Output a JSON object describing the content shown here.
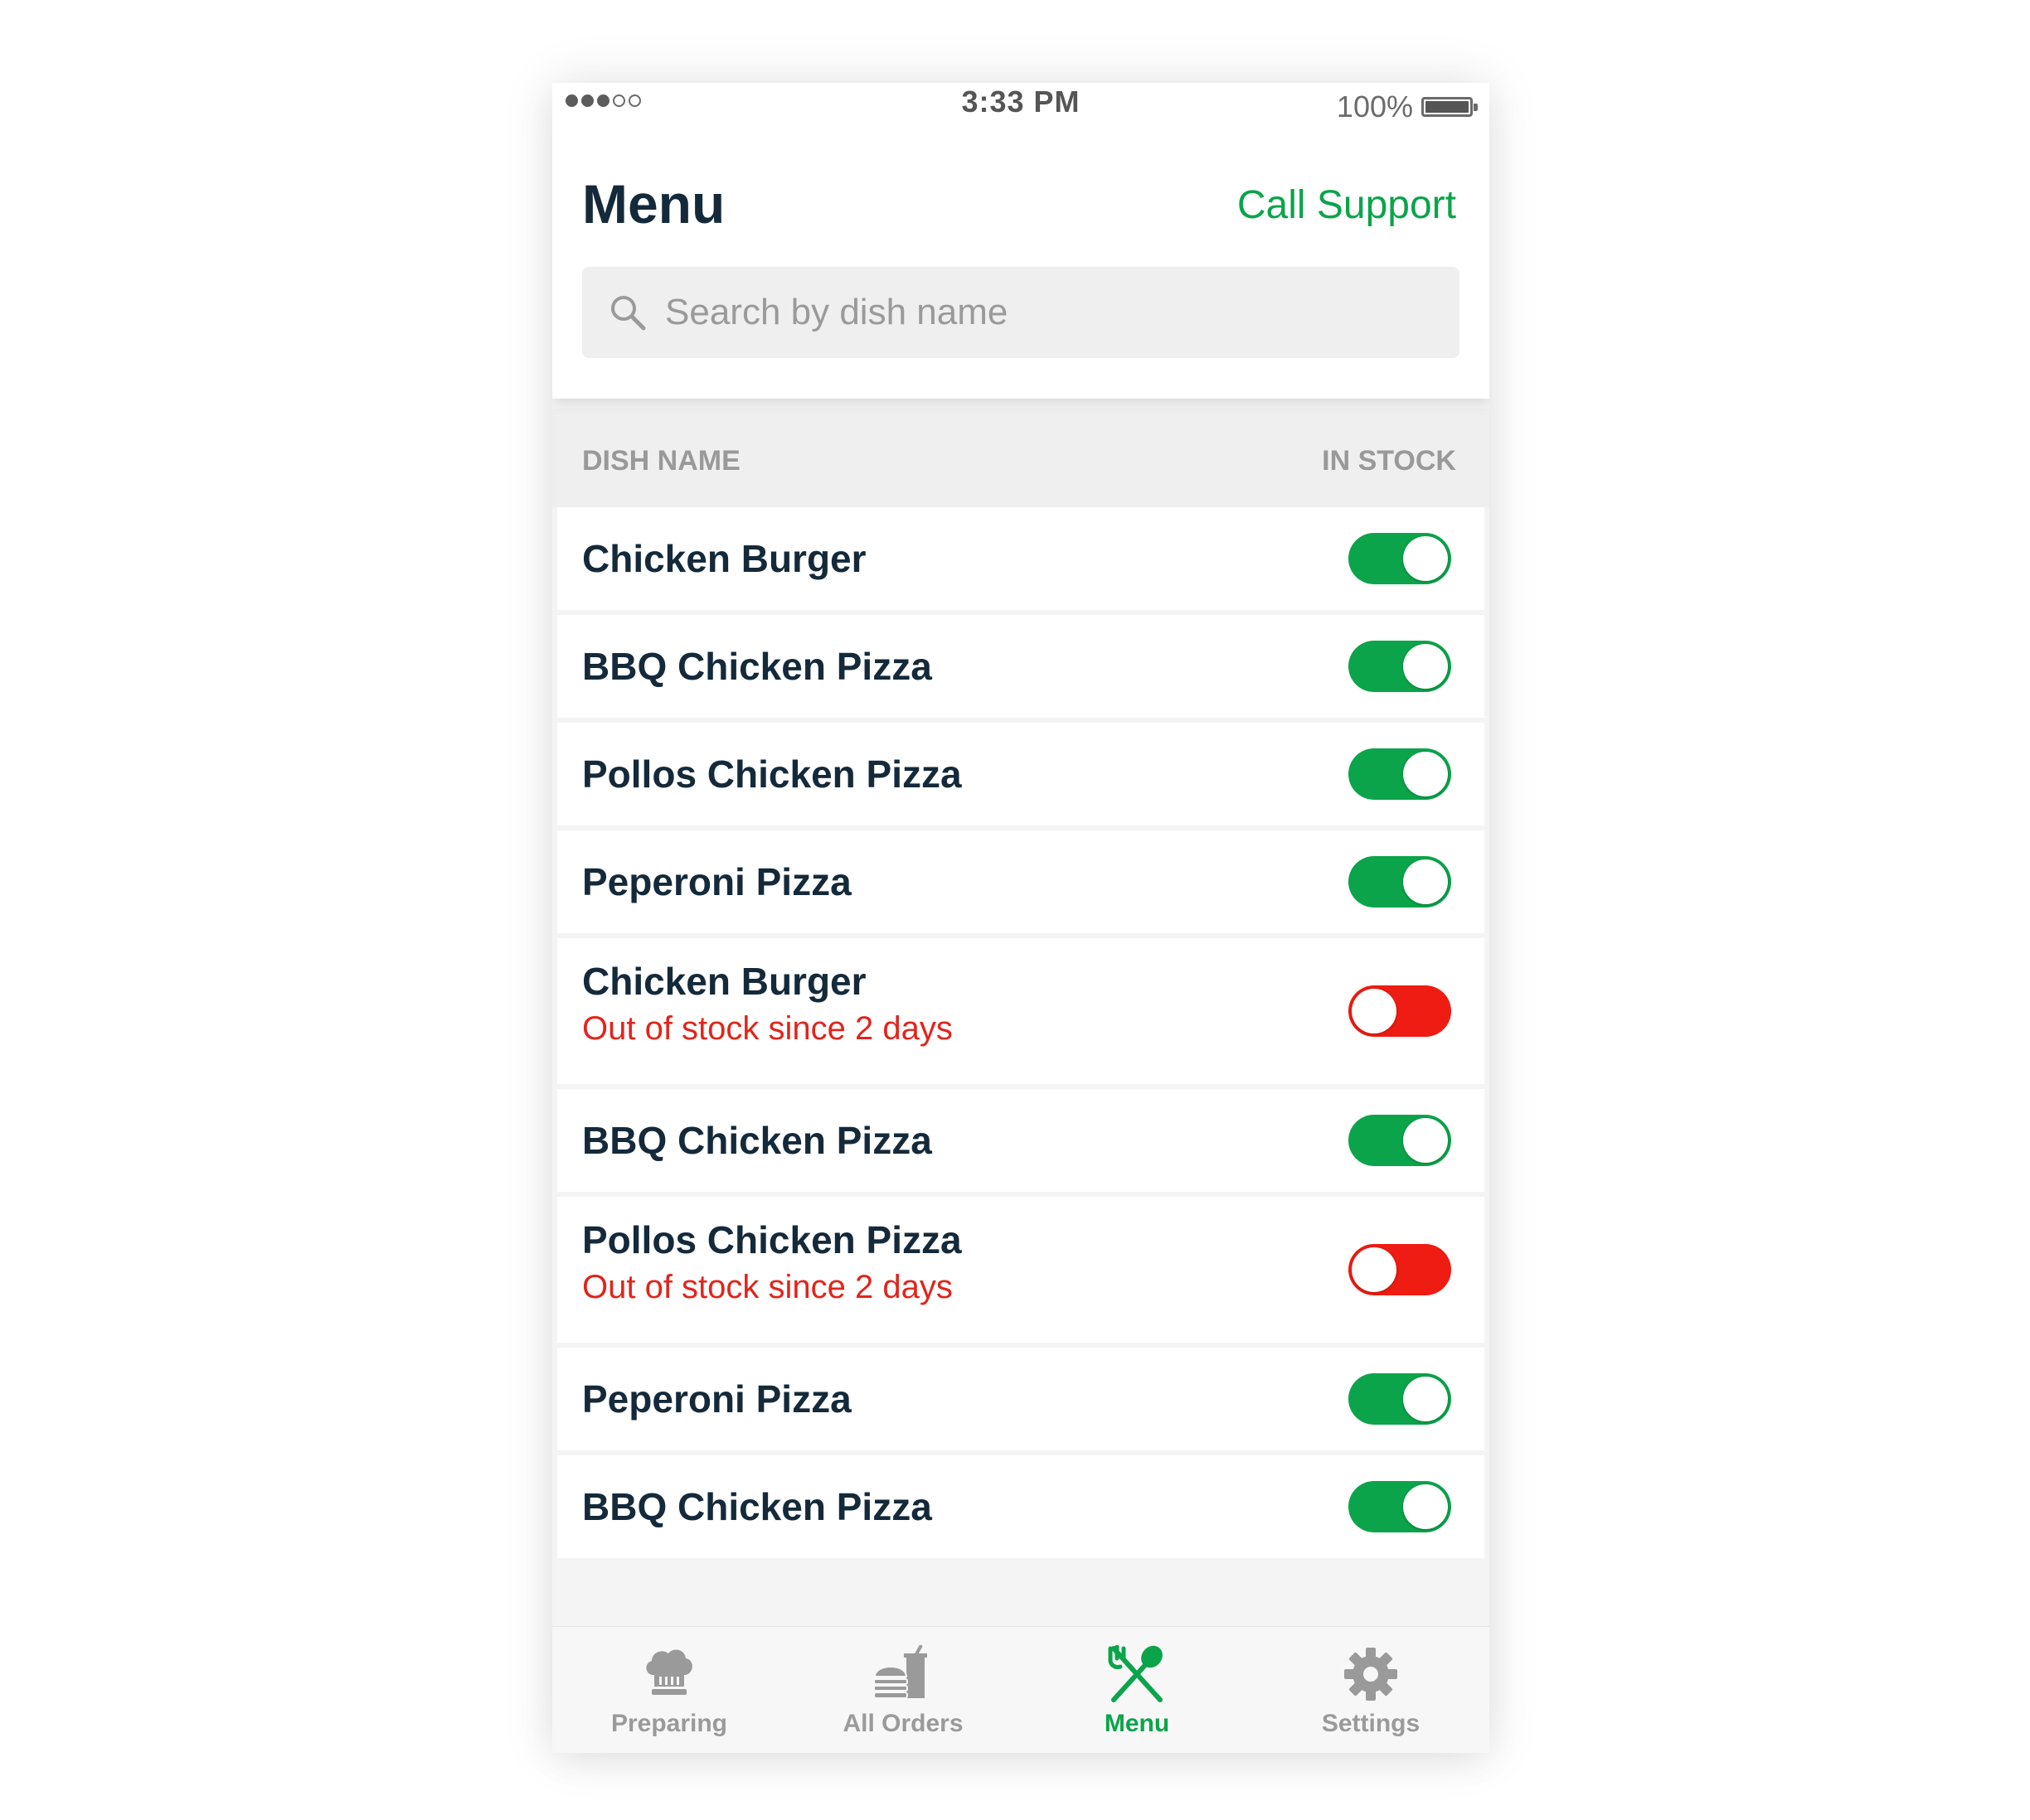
{
  "status_bar": {
    "time": "3:33 PM",
    "battery": "100%"
  },
  "header": {
    "title": "Menu",
    "call_support": "Call Support"
  },
  "search": {
    "placeholder": "Search by dish name"
  },
  "columns": {
    "left": "DISH NAME",
    "right": "IN STOCK"
  },
  "dishes": [
    {
      "name": "Chicken Burger",
      "in_stock": true,
      "status": ""
    },
    {
      "name": "BBQ Chicken Pizza",
      "in_stock": true,
      "status": ""
    },
    {
      "name": "Pollos Chicken Pizza",
      "in_stock": true,
      "status": ""
    },
    {
      "name": "Peperoni Pizza",
      "in_stock": true,
      "status": ""
    },
    {
      "name": "Chicken Burger",
      "in_stock": false,
      "status": "Out of stock since 2 days"
    },
    {
      "name": "BBQ Chicken Pizza",
      "in_stock": true,
      "status": ""
    },
    {
      "name": "Pollos Chicken Pizza",
      "in_stock": false,
      "status": "Out of stock since 2 days"
    },
    {
      "name": "Peperoni Pizza",
      "in_stock": true,
      "status": ""
    },
    {
      "name": "BBQ Chicken Pizza",
      "in_stock": true,
      "status": ""
    }
  ],
  "tabs": [
    {
      "label": "Preparing",
      "icon": "chef-hat-icon",
      "active": false
    },
    {
      "label": "All Orders",
      "icon": "burger-drink-icon",
      "active": false
    },
    {
      "label": "Menu",
      "icon": "fork-spoon-icon",
      "active": true
    },
    {
      "label": "Settings",
      "icon": "gear-icon",
      "active": false
    }
  ],
  "colors": {
    "accent": "#0ba44a",
    "danger": "#ee1c12",
    "title": "#142a3b"
  }
}
